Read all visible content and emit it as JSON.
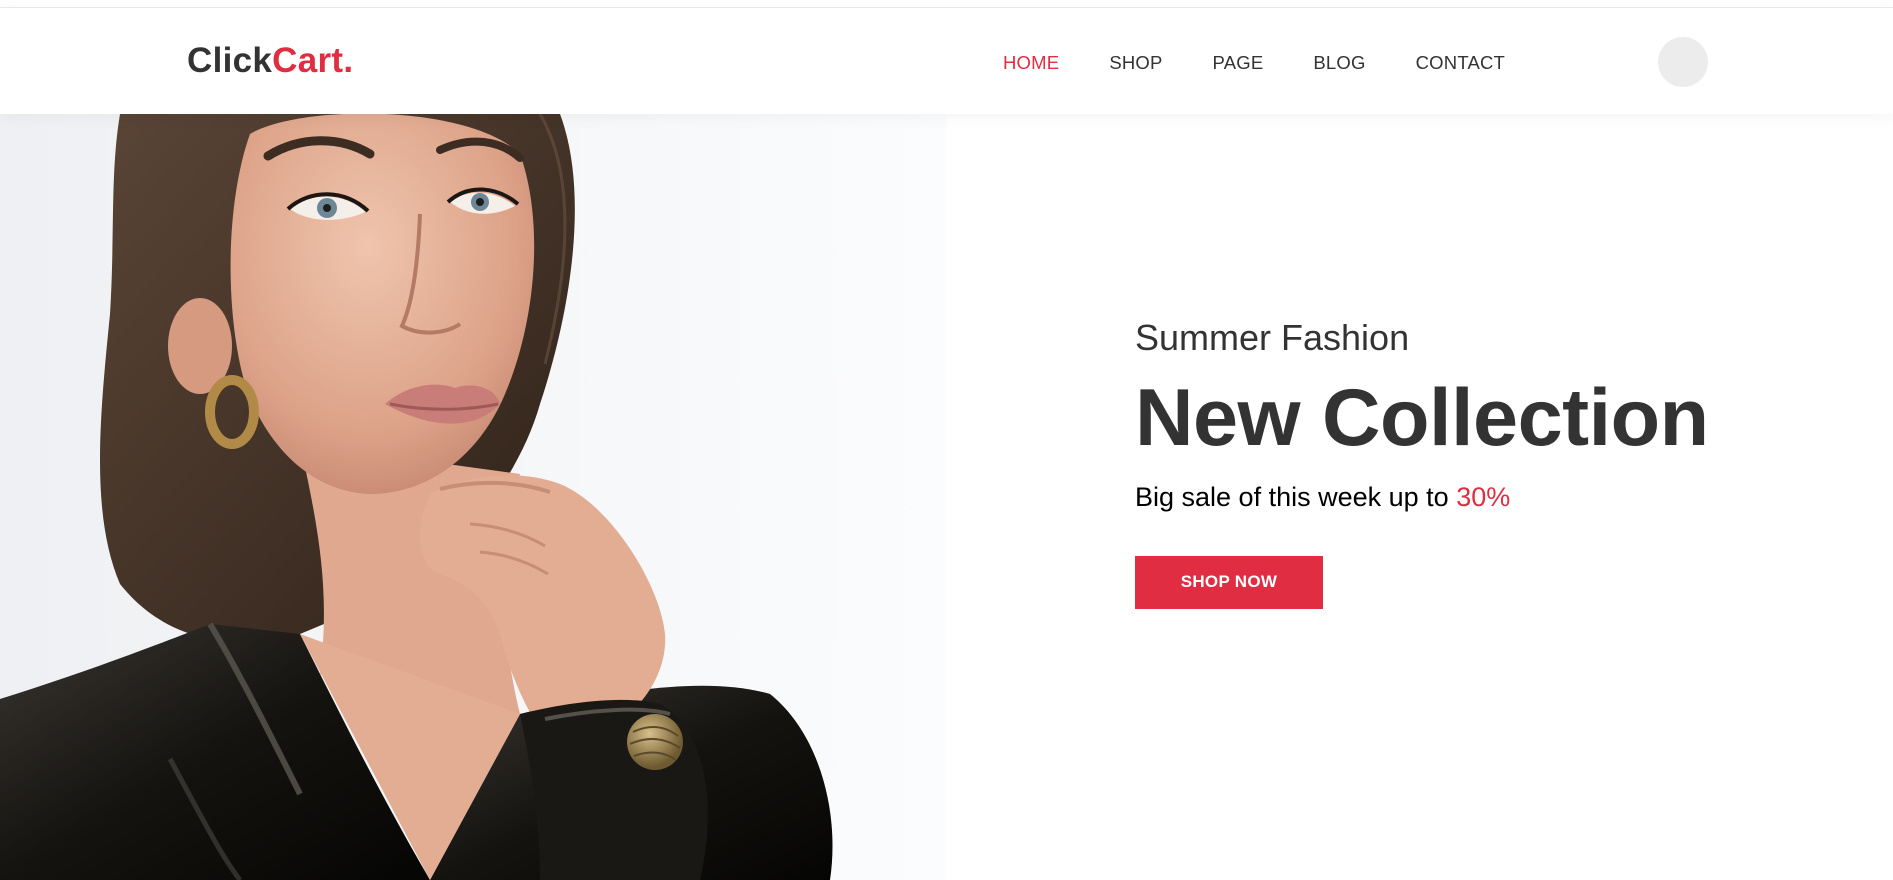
{
  "brand": {
    "part1": "Click",
    "part2": "Cart."
  },
  "nav": {
    "items": [
      {
        "label": "HOME",
        "active": true
      },
      {
        "label": "SHOP",
        "active": false
      },
      {
        "label": "PAGE",
        "active": false
      },
      {
        "label": "BLOG",
        "active": false
      },
      {
        "label": "CONTACT",
        "active": false
      }
    ]
  },
  "hero": {
    "subtitle": "Summer Fashion",
    "title": "New Collection",
    "sale_text": "Big sale of this week up to ",
    "sale_percent": "30%",
    "button_label": "SHOP NOW",
    "image": "model-in-black-blazer-image"
  },
  "colors": {
    "accent": "#e12d42",
    "text": "#333333",
    "avatar_bg": "#ececec"
  }
}
